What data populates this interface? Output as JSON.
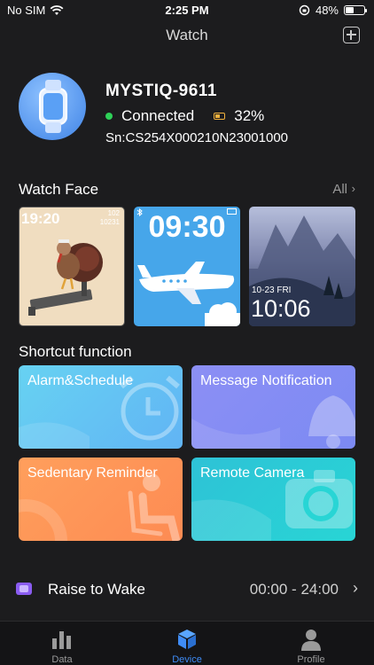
{
  "status_bar": {
    "carrier": "No SIM",
    "time": "2:25 PM",
    "battery": "48%"
  },
  "header": {
    "title": "Watch"
  },
  "device": {
    "name": "MYSTIQ-9611",
    "status": "Connected",
    "battery": "32%",
    "serial": "Sn:CS254X000210N23001000"
  },
  "watch_face": {
    "title": "Watch Face",
    "all_label": "All",
    "faces": [
      {
        "time": "19:20",
        "stat1": "102",
        "stat2": "10231"
      },
      {
        "time": "09:30"
      },
      {
        "date": "10-23 FRI",
        "time": "10:06"
      }
    ]
  },
  "shortcuts": {
    "title": "Shortcut function",
    "items": [
      {
        "label": "Alarm&Schedule"
      },
      {
        "label": "Message Notification"
      },
      {
        "label": "Sedentary Reminder"
      },
      {
        "label": "Remote Camera"
      }
    ]
  },
  "raise_to_wake": {
    "label": "Raise to Wake",
    "value": "00:00 - 24:00"
  },
  "tabs": [
    {
      "label": "Data"
    },
    {
      "label": "Device"
    },
    {
      "label": "Profile"
    }
  ],
  "colors": {
    "accent": "#3f8cf6",
    "connected": "#2ed158",
    "battery": "#f3b23e"
  }
}
